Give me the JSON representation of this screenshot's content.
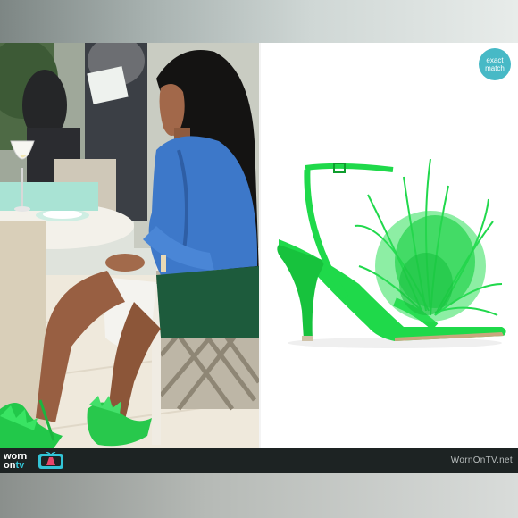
{
  "badge": {
    "line1": "exact",
    "line2": "match"
  },
  "logo": {
    "word1": "worn",
    "word2_a": "on",
    "word2_b": "tv"
  },
  "watermark": "WornOnTV.net",
  "colors": {
    "badge_bg": "#47b9c6",
    "shoe_green": "#1fd94a",
    "blouse_blue": "#3d78c9",
    "footer_bg": "#1d2323"
  },
  "icons": {
    "logo": "dress-tv-icon"
  }
}
